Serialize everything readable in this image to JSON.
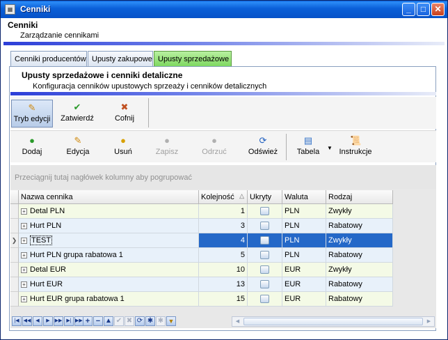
{
  "window": {
    "title": "Cenniki"
  },
  "header": {
    "title": "Cenniki",
    "subtitle": "Zarządzanie cennikami"
  },
  "tabs": [
    {
      "label": "Cenniki producentów"
    },
    {
      "label": "Upusty zakupowe"
    },
    {
      "label": "Upusty sprzedażowe"
    }
  ],
  "panel": {
    "title": "Upusty sprzedażowe i cenniki detaliczne",
    "subtitle": "Konfiguracja cenników upustowych sprzeaży i cenników detalicznych"
  },
  "toolbar1": {
    "edit_mode": "Tryb edycji",
    "approve": "Zatwierdź",
    "undo": "Cofnij"
  },
  "toolbar2": {
    "add": "Dodaj",
    "edit": "Edycja",
    "delete": "Usuń",
    "save": "Zapisz",
    "discard": "Odrzuć",
    "refresh": "Odśwież",
    "table": "Tabela",
    "instructions": "Instrukcje"
  },
  "grid": {
    "group_hint": "Przeciągnij tutaj nagłówek kolumny aby pogrupować",
    "columns": [
      "Nazwa cennika",
      "Kolejność",
      "Ukryty",
      "Waluta",
      "Rodzaj"
    ],
    "rows": [
      {
        "name": "Detal PLN",
        "order": "1",
        "currency": "PLN",
        "type": "Zwykły"
      },
      {
        "name": "Hurt PLN",
        "order": "3",
        "currency": "PLN",
        "type": "Rabatowy"
      },
      {
        "name": "TEST",
        "order": "4",
        "currency": "PLN",
        "type": "Zwykły"
      },
      {
        "name": "Hurt PLN grupa rabatowa 1",
        "order": "5",
        "currency": "PLN",
        "type": "Rabatowy"
      },
      {
        "name": "Detal EUR",
        "order": "10",
        "currency": "EUR",
        "type": "Zwykły"
      },
      {
        "name": "Hurt EUR",
        "order": "13",
        "currency": "EUR",
        "type": "Rabatowy"
      },
      {
        "name": "Hurt EUR grupa rabatowa 1",
        "order": "15",
        "currency": "EUR",
        "type": "Rabatowy"
      }
    ],
    "selected_row": 2,
    "sort_column": "Kolejność",
    "sort_direction": "ascending"
  },
  "colors": {
    "title_bar": "#0a5fd8",
    "active_tab": "#7ed860",
    "selection": "#2468c8"
  }
}
